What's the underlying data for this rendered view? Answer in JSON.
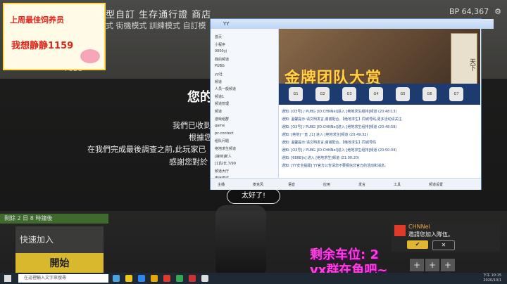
{
  "game": {
    "topnav": "型自訂  生存通行證  商店",
    "topnav2": "式  街機模式  訓練模式  自訂模",
    "bp": "BP 64,367",
    "left_pubg": "PUBG",
    "banner": "剩餘 2 日 8 時鐘後",
    "mode": "快速加入",
    "start": "開始",
    "modal": {
      "title": "您的",
      "lines": [
        "我們已收到",
        "根據您",
        "在我們完成最後調查之前,此玩家已",
        "感謝您對於"
      ],
      "ok": "太好了!"
    }
  },
  "promo": {
    "line1": "上周最佳饲养员",
    "line2": "我想静静1159"
  },
  "overlay": {
    "remaining": "剩余车位: 2",
    "wechat": "vx群在鱼吧~"
  },
  "yy": {
    "title": "YY",
    "side": [
      "首页",
      "小程序",
      "0000yj",
      "我的频道",
      "PUBG",
      "yy社",
      "频道",
      "人员一般频道",
      "频道1",
      "频道管理",
      "频道",
      "游戏组群",
      "game",
      "pc-contect",
      "组队问题",
      "绝地求生频道",
      "[接待]新人",
      "[1]队长,7/99",
      "频道大厅",
      "麦序模式"
    ],
    "banner": "金牌团队大赏",
    "scroll": "天下",
    "games": [
      "G1",
      "G2",
      "G3",
      "G4",
      "G5",
      "G6",
      "G7"
    ],
    "chat": [
      "通知: [O3号]丿PUBG [ID:CHNNel]进入 [绝地求生组排]频道 (20:48:13)",
      "通知: 温馨提示:请文明发言,谢谢配合。【绝地求生】同城号码,更多活动请关注",
      "通知: [O3号]丿PUBG [ID:CHNNel]进入 [绝地求生组排]频道 (20:48:59)",
      "通知: [绝地]一直 ,[1] 进入 [绝地求生]频道 (20:49:32)",
      "通知: 温馨提示:请文明发言,谢谢配合。【绝地求生】同城号码",
      "通知: [O3号]丿PUBG [ID:CHNNel]进入 [绝地求生组排]频道 (20:50:04)",
      "通知: [6888]n] 进入 [绝地求生]频道 (21:00:20)",
      "通知: [YY安全提醒] YY官方公告请您不要相信非官方的活动和消息。"
    ],
    "bottom": [
      "主播",
      "麦克风",
      "语音",
      "应用",
      "发言",
      "工具",
      "频道设置"
    ]
  },
  "invite": {
    "name": "CHNNel",
    "message": "邀請您加入隊伍。",
    "accept": "✔",
    "decline": "✕"
  },
  "slots": [
    "+",
    "+",
    "+"
  ],
  "taskbar": {
    "search": "在這裡輸入文字來搜尋",
    "time": "下午 10:15",
    "date": "2020/10/1"
  }
}
